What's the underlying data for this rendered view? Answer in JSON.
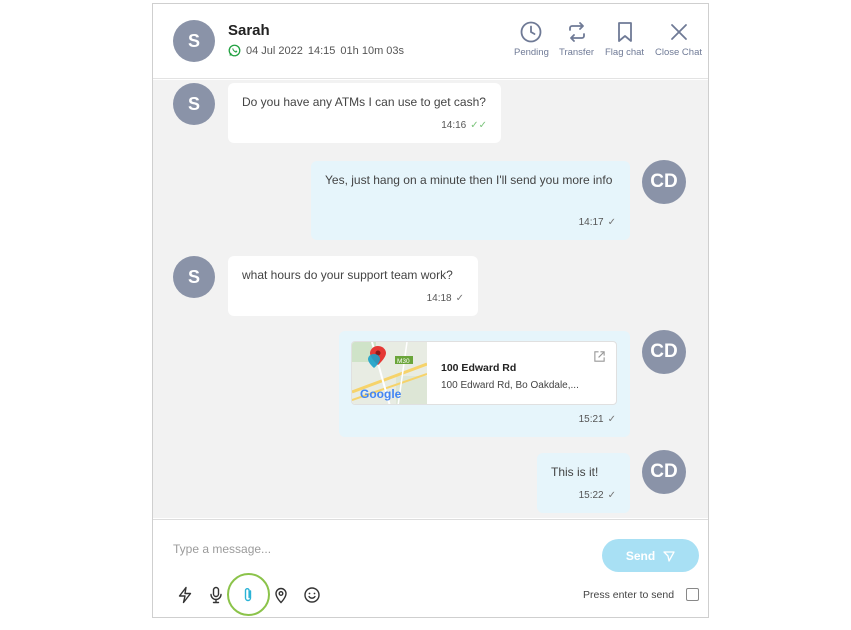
{
  "header": {
    "avatar_initial": "S",
    "name": "Sarah",
    "date": "04 Jul 2022",
    "time": "14:15",
    "duration": "01h 10m 03s",
    "actions": [
      {
        "label": "Pending",
        "icon": "clock-icon"
      },
      {
        "label": "Transfer",
        "icon": "transfer-icon"
      },
      {
        "label": "Flag chat",
        "icon": "bookmark-icon"
      },
      {
        "label": "Close Chat",
        "icon": "close-icon"
      }
    ]
  },
  "messages": [
    {
      "direction": "in",
      "avatar": "S",
      "text": "Do you have any ATMs I can use to get cash?",
      "time": "14:16",
      "status": "read"
    },
    {
      "direction": "out",
      "avatar": "CD",
      "text": "Yes, just hang on a minute then I'll send you more info",
      "time": "14:17",
      "status": "sent"
    },
    {
      "direction": "in",
      "avatar": "S",
      "text": "what hours do your support team work?",
      "time": "14:18",
      "status": "sent"
    },
    {
      "direction": "out",
      "avatar": "CD",
      "type": "location",
      "location_title": "100 Edward Rd",
      "location_address": "100 Edward Rd, Bo Oakdale,...",
      "map_road_label": "M30",
      "map_brand": "Google",
      "time": "15:21",
      "status": "sent"
    },
    {
      "direction": "out",
      "avatar": "CD",
      "text": "This is it!",
      "time": "15:22",
      "status": "sent"
    }
  ],
  "composer": {
    "placeholder": "Type a message...",
    "send_label": "Send",
    "press_enter_label": "Press enter to send",
    "press_enter_checked": false,
    "tools": [
      "lightning-icon",
      "microphone-icon",
      "paperclip-icon",
      "location-pin-icon",
      "smiley-icon"
    ]
  },
  "colors": {
    "avatar": "#8a93a8",
    "outgoing_bubble": "#e6f5fb",
    "send_button": "#a8e0f4",
    "highlight_ring": "#8bc34a",
    "action_icon": "#6f7a96"
  }
}
